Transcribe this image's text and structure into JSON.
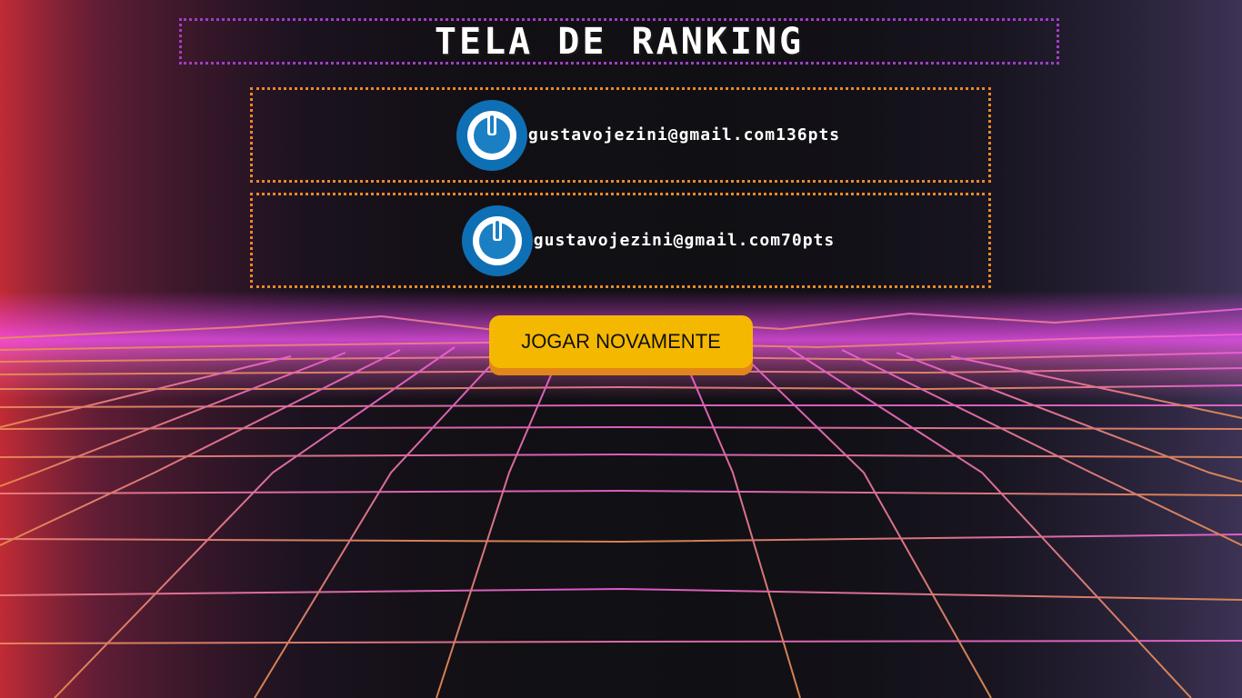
{
  "page": {
    "title": "TELA DE RANKING"
  },
  "ranking": [
    {
      "email": "gustavojezini@gmail.com",
      "score": "136pts",
      "avatar_icon": "power-icon"
    },
    {
      "email": "gustavojezini@gmail.com",
      "score": "70pts",
      "avatar_icon": "power-icon"
    }
  ],
  "actions": {
    "play_again_label": "JOGAR NOVAMENTE"
  },
  "colors": {
    "title_border": "#a23dc4",
    "card_border": "#e9882a",
    "button_bg": "#f5b800",
    "button_shadow": "#e0861a",
    "avatar_blue": "#0f6fb5"
  }
}
